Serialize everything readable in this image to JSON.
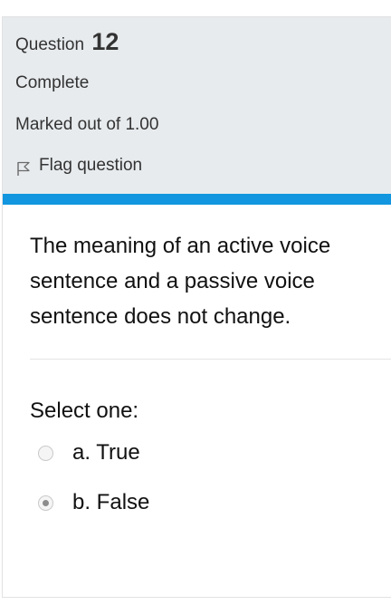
{
  "question": {
    "prefix": "Question",
    "number": "12",
    "state": "Complete",
    "grade": "Marked out of 1.00",
    "flag_label": "Flag question",
    "text": "The meaning of an active voice sentence and a passive voice sentence does not change.",
    "prompt": "Select one:",
    "options": [
      {
        "label": "a. True",
        "checked": false
      },
      {
        "label": "b. False",
        "checked": true
      }
    ],
    "accent_color": "#1196df",
    "info_background": "#e7ebee",
    "icons": {
      "flag": "flag-icon"
    }
  }
}
